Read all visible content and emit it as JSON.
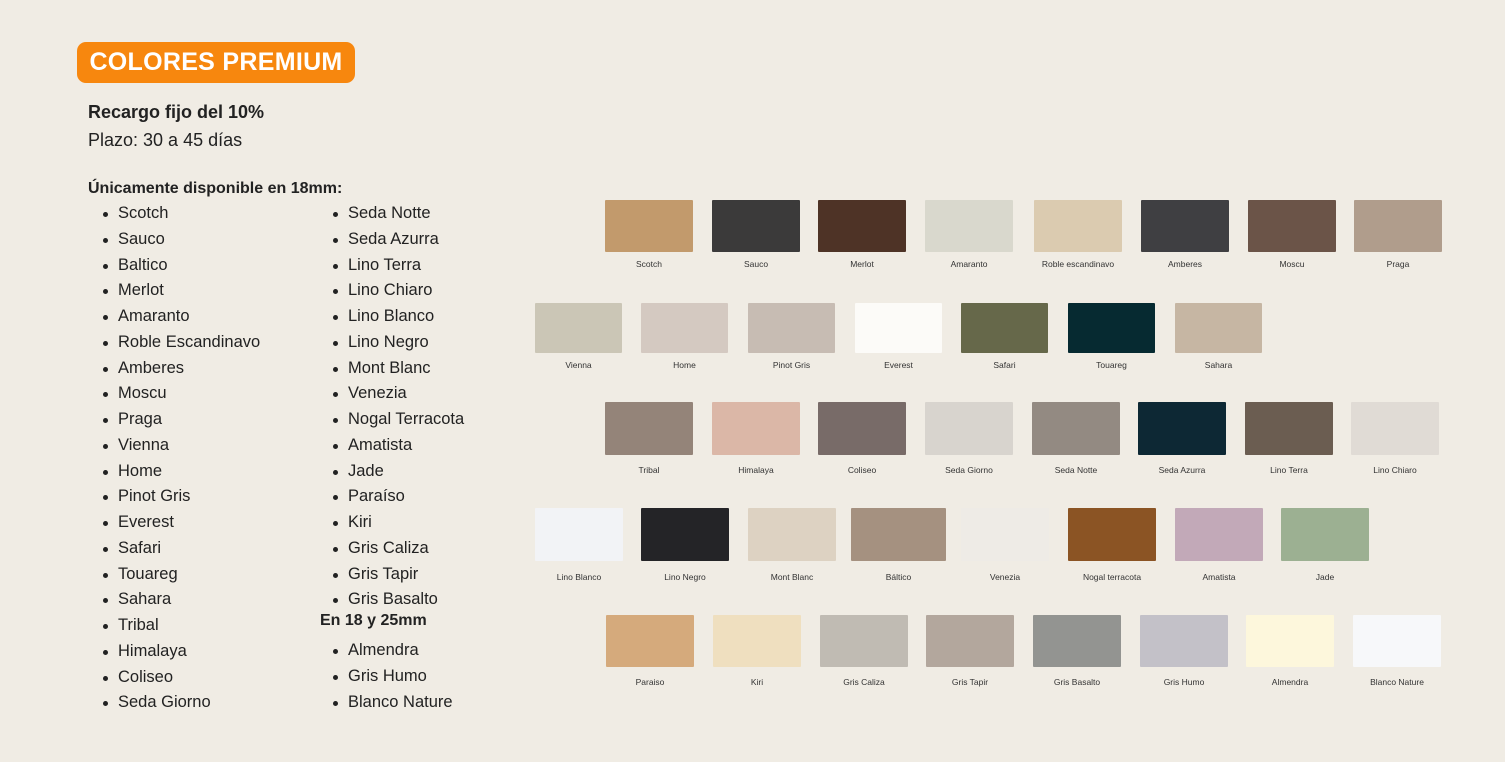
{
  "badge": "COLORES PREMIUM",
  "surcharge": "Recargo fijo del 10%",
  "term": "Plazo: 30 a 45 días",
  "only18_heading": "Únicamente disponible en 18mm:",
  "list_col1": [
    "Scotch",
    "Sauco",
    "Baltico",
    "Merlot",
    "Amaranto",
    "Roble Escandinavo",
    "Amberes",
    "Moscu",
    "Praga",
    "Vienna",
    "Home",
    "Pinot Gris",
    "Everest",
    "Safari",
    "Touareg",
    "Sahara",
    "Tribal",
    "Himalaya",
    "Coliseo",
    "Seda Giorno"
  ],
  "list_col2": [
    "Seda Notte",
    "Seda Azurra",
    "Lino Terra",
    "Lino Chiaro",
    "Lino Blanco",
    "Lino Negro",
    "Mont Blanc",
    "Venezia",
    "Nogal Terracota",
    "Amatista",
    "Jade",
    "Paraíso",
    "Kiri",
    "Gris Caliza",
    "Gris Tapir",
    "Gris Basalto"
  ],
  "heading_18_25": "En 18 y 25mm",
  "list_col3": [
    "Almendra",
    "Gris Humo",
    "Blanco Nature"
  ],
  "swatch_rows": [
    [
      {
        "label": "Scotch",
        "color": "#c29a6c"
      },
      {
        "label": "Sauco",
        "color": "#3b3a3a"
      },
      {
        "label": "Merlot",
        "color": "#4e3326"
      },
      {
        "label": "Amaranto",
        "color": "#d9d8cd"
      },
      {
        "label": "Roble escandinavo",
        "color": "#dbcbb0"
      },
      {
        "label": "Amberes",
        "color": "#3f3f42"
      },
      {
        "label": "Moscu",
        "color": "#6b5448"
      },
      {
        "label": "Praga",
        "color": "#b09d8c"
      }
    ],
    [
      {
        "label": "Vienna",
        "color": "#cbc6b6"
      },
      {
        "label": "Home",
        "color": "#d4c9c1"
      },
      {
        "label": "Pinot Gris",
        "color": "#c7bcb3"
      },
      {
        "label": "Everest",
        "color": "#fcfbf8"
      },
      {
        "label": "Safari",
        "color": "#66684a"
      },
      {
        "label": "Touareg",
        "color": "#062a31"
      },
      {
        "label": "Sahara",
        "color": "#c6b6a3"
      }
    ],
    [
      {
        "label": "Tribal",
        "color": "#948479"
      },
      {
        "label": "Himalaya",
        "color": "#dbb7a7"
      },
      {
        "label": "Coliseo",
        "color": "#786b68"
      },
      {
        "label": "Seda Giorno",
        "color": "#d8d4ce"
      },
      {
        "label": "Seda Notte",
        "color": "#938a82"
      },
      {
        "label": "Seda Azurra",
        "color": "#0d2834"
      },
      {
        "label": "Lino Terra",
        "color": "#6b5d51"
      },
      {
        "label": "Lino Chiaro",
        "color": "#e0dbd5"
      }
    ],
    [
      {
        "label": "Lino Blanco",
        "color": "#f2f3f6"
      },
      {
        "label": "Lino Negro",
        "color": "#242427"
      },
      {
        "label": "Mont Blanc",
        "color": "#ddd2c2"
      },
      {
        "label": "Báltico",
        "color": "#a59180"
      },
      {
        "label": "Venezia",
        "color": "#eeebe6"
      },
      {
        "label": "Nogal terracota",
        "color": "#8b5424"
      },
      {
        "label": "Amatista",
        "color": "#c2a9b8"
      },
      {
        "label": "Jade",
        "color": "#9cb092"
      }
    ],
    [
      {
        "label": "Paraiso",
        "color": "#d5aa7c"
      },
      {
        "label": "Kiri",
        "color": "#efdfbf"
      },
      {
        "label": "Gris Caliza",
        "color": "#c0bbb3"
      },
      {
        "label": "Gris Tapir",
        "color": "#b3a79d"
      },
      {
        "label": "Gris Basalto",
        "color": "#939491"
      },
      {
        "label": "Gris Humo",
        "color": "#c3c1c8"
      },
      {
        "label": "Almendra",
        "color": "#fdf7dc"
      },
      {
        "label": "Blanco Nature",
        "color": "#f7f8fa"
      }
    ]
  ]
}
